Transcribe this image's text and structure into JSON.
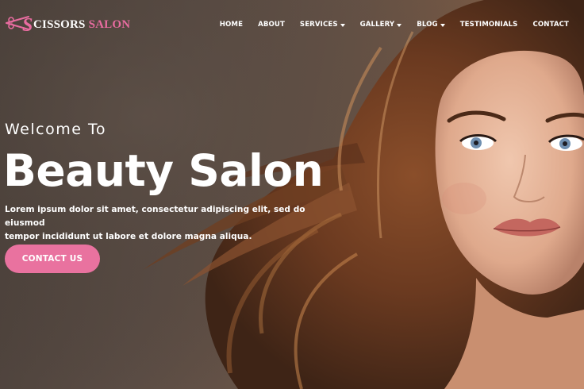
{
  "brand": {
    "name_part1": "CISSORS",
    "name_part2": "SALON",
    "accent_color": "#e86ca0"
  },
  "nav": {
    "items": [
      {
        "label": "HOME",
        "has_dropdown": false
      },
      {
        "label": "ABOUT",
        "has_dropdown": false
      },
      {
        "label": "SERVICES",
        "has_dropdown": true
      },
      {
        "label": "GALLERY",
        "has_dropdown": true
      },
      {
        "label": "BLOG",
        "has_dropdown": true
      },
      {
        "label": "TESTIMONIALS",
        "has_dropdown": false
      },
      {
        "label": "CONTACT",
        "has_dropdown": false
      }
    ]
  },
  "hero": {
    "eyebrow": "Welcome To",
    "headline": "Beauty Salon",
    "lead_line1": "Lorem ipsum dolor sit amet, consectetur adipiscing elit, sed do eiusmod",
    "lead_line2": "tempor incididunt ut labore et dolore magna aliqua.",
    "cta_label": "CONTACT US",
    "cta_color": "#e9729f",
    "background_image": "woman-with-long-brown-hair-portrait"
  }
}
